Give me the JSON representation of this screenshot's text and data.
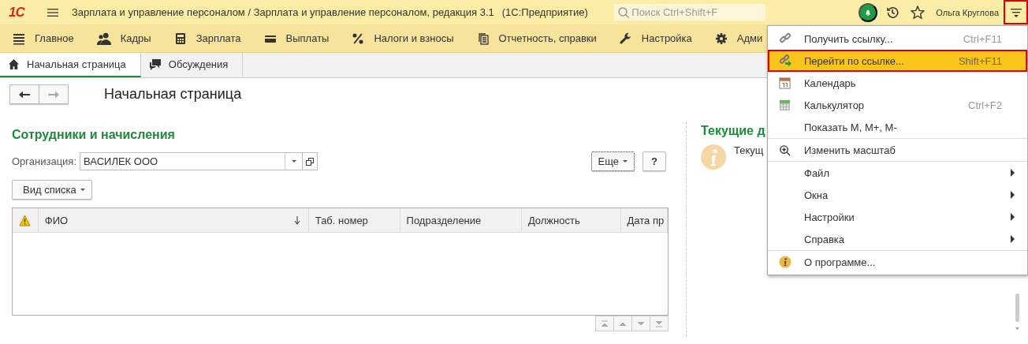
{
  "topbar": {
    "logo": "1С",
    "title": "Зарплата и управление персоналом / Зарплата и управление персоналом, редакция 3.1",
    "app": "(1С:Предприятие)",
    "search": {
      "placeholder": "Поиск Ctrl+Shift+F"
    },
    "user": "Ольга Круглова",
    "menu_button": {
      "outlined": true
    }
  },
  "sections": [
    {
      "label": "Главное"
    },
    {
      "label": "Кадры"
    },
    {
      "label": "Зарплата"
    },
    {
      "label": "Выплаты"
    },
    {
      "label": "Налоги и взносы"
    },
    {
      "label": "Отчетность, справки"
    },
    {
      "label": "Настройка"
    },
    {
      "label": "Адми"
    }
  ],
  "tabs": [
    {
      "label": "Начальная страница",
      "selected": true
    },
    {
      "label": "Обсуждения",
      "selected": false
    }
  ],
  "page_title": "Начальная страница",
  "left": {
    "heading": "Сотрудники и начисления",
    "org_label": "Организация:",
    "org_value": "ВАСИЛЕК ООО",
    "more_button": "Еще",
    "help_button": "?",
    "view_button": "Вид списка",
    "columns": [
      "ФИО",
      "Таб. номер",
      "Подразделение",
      "Должность",
      "Дата пр"
    ]
  },
  "right": {
    "heading": "Текущие д",
    "text": "Текущ"
  },
  "menu": {
    "groups": [
      [
        {
          "label": "Получить ссылку...",
          "shortcut": "Ctrl+F11",
          "selected": false,
          "outlined": false
        },
        {
          "label": "Перейти по ссылке...",
          "shortcut": "Shift+F11",
          "selected": true,
          "outlined": true
        },
        {
          "label": "Календарь",
          "selected": false,
          "outlined": false
        },
        {
          "label": "Калькулятор",
          "shortcut": "Ctrl+F2",
          "selected": false,
          "outlined": false
        },
        {
          "label": "Показать М, М+, М-",
          "selected": false,
          "outlined": false
        }
      ],
      [
        {
          "label": "Изменить масштаб",
          "selected": false,
          "outlined": false
        }
      ],
      [
        {
          "label": "Файл",
          "submenu": true,
          "selected": false,
          "outlined": false
        },
        {
          "label": "Окна",
          "submenu": true,
          "selected": false,
          "outlined": false
        },
        {
          "label": "Настройки",
          "submenu": true,
          "selected": false,
          "outlined": false
        },
        {
          "label": "Справка",
          "submenu": true,
          "selected": false,
          "outlined": false
        }
      ],
      [
        {
          "label": "О программе...",
          "selected": false,
          "outlined": false
        }
      ]
    ]
  }
}
